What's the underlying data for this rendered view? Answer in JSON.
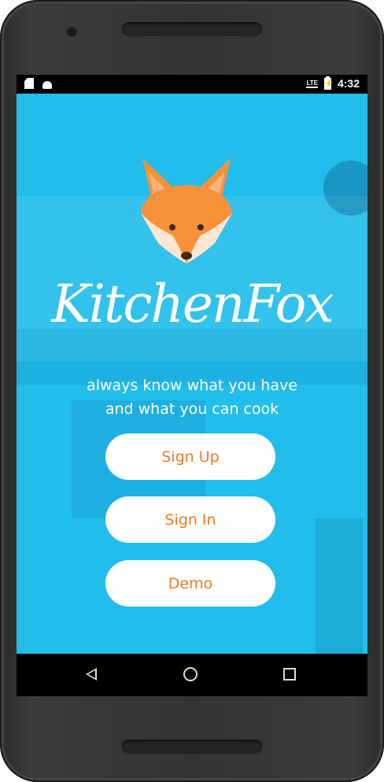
{
  "status_bar": {
    "time": "4:32",
    "network": "LTE",
    "icons": [
      "sd-card-icon",
      "android-icon",
      "lte-signal-icon",
      "battery-charging-icon"
    ]
  },
  "app": {
    "name": "KitchenFox",
    "tagline_line1": "always know what you have",
    "tagline_line2": "and what you can cook",
    "accent_color": "#f37b1d",
    "background_color": "#21bdeb"
  },
  "buttons": {
    "sign_up": "Sign Up",
    "sign_in": "Sign In",
    "demo": "Demo"
  },
  "nav_bar": {
    "icons": [
      "back-icon",
      "home-icon",
      "recent-apps-icon"
    ]
  }
}
